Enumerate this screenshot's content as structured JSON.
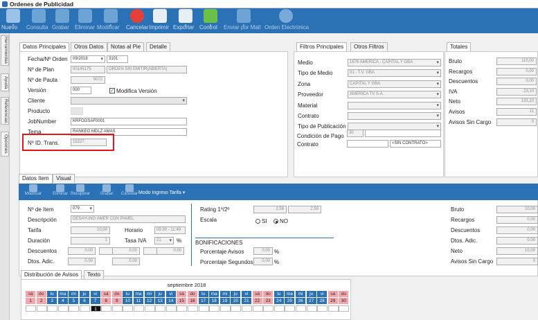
{
  "window": {
    "title": "Ordenes de Publicidad"
  },
  "toolbar": [
    {
      "label": "Nuevo",
      "dd": true,
      "color": "#9cc2e8",
      "icon": "new-icon",
      "enabled": true
    },
    {
      "label": "Consulta",
      "color": "#7fb0dd",
      "icon": "search-icon",
      "enabled": false
    },
    {
      "label": "Grabar",
      "color": "#7fb0dd",
      "icon": "save-icon",
      "enabled": false
    },
    {
      "label": "Eliminar",
      "color": "#7fb0dd",
      "icon": "delete-icon",
      "enabled": false
    },
    {
      "label": "Modificar",
      "dd": true,
      "color": "#7fb0dd",
      "icon": "edit-icon",
      "enabled": false
    },
    {
      "label": "Cancelar",
      "color": "#e4403a",
      "icon": "cancel-icon",
      "enabled": true
    },
    {
      "label": "Imprimir",
      "color": "#e9eef3",
      "icon": "printer-icon",
      "enabled": true
    },
    {
      "label": "Exportar",
      "dd": true,
      "color": "#e9eef3",
      "icon": "export-icon",
      "enabled": true
    },
    {
      "label": "Control",
      "dd": true,
      "color": "#6cc04a",
      "icon": "control-icon",
      "enabled": true
    },
    {
      "label": "Enviar por Mail",
      "dd": true,
      "color": "#7fb0dd",
      "icon": "mail-icon",
      "enabled": false
    },
    {
      "label": "Orden Electrónica",
      "color": "#8cb8e2",
      "icon": "electronic-order-icon",
      "enabled": false
    }
  ],
  "sidebar": [
    "Herramientas",
    "Ayuda",
    "Referencias",
    "Opciones"
  ],
  "main_tabs": [
    "Datos Principales",
    "Otros Datos",
    "Notas al Pie",
    "Detalle"
  ],
  "main": {
    "fecha_label": "Fecha/Nº Orden",
    "fecha": "09/2018",
    "orden": "3101",
    "plan_label": "Nº de Plan",
    "plan": "00145175",
    "plan_desc": "ORDEN SIN EMITIR(ABIERTA)",
    "pauta_label": "Nº de Pauta",
    "pauta": "0072",
    "version_label": "Versión",
    "version": "000",
    "modifica": "Modifica Versión",
    "cliente_label": "Cliente",
    "producto_label": "Producto",
    "job_label": "JobNumber",
    "job": "KRFOOSAF0001",
    "tema_label": "Tema",
    "tema": "RANKEO MDLZ AMAS",
    "trans_label": "Nº ID. Trans.",
    "trans": "15227"
  },
  "filter_tabs": [
    "Filtros Principales",
    "Otros Filtros"
  ],
  "filters": [
    {
      "label": "Medio",
      "value": "1676 AMERICA - CAPITAL Y GBA"
    },
    {
      "label": "Tipo de Medio",
      "value": "01 - T.V. GBA"
    },
    {
      "label": "Zona",
      "value": "CAPITAL Y GBA"
    },
    {
      "label": "Proveedor",
      "value": "AMERICA TV S.A."
    },
    {
      "label": "Material",
      "value": ""
    },
    {
      "label": "Contrato",
      "value": ""
    },
    {
      "label": "Tipo de Publicación",
      "value": ""
    }
  ],
  "condicion": {
    "label": "Condición de Pago",
    "value": "30"
  },
  "contrato2": {
    "label": "Contrato",
    "value": "<SIN CONTRATO>"
  },
  "totals_tab": "Totales",
  "totals": [
    {
      "label": "Bruto",
      "value": "110,00"
    },
    {
      "label": "Recargos",
      "value": "0,00"
    },
    {
      "label": "Descuentos",
      "value": "0,00"
    },
    {
      "label": "IVA",
      "value": "23,10"
    },
    {
      "label": "Neto",
      "value": "133,10"
    },
    {
      "label": "Avisos",
      "value": "11"
    },
    {
      "label": "Avisos Sin Cargo",
      "value": "0"
    }
  ],
  "item_tabs": [
    "Datos Item",
    "Visual"
  ],
  "item_toolbar": [
    "Modificar",
    "Eliminar",
    "Recuperar",
    "Grabar",
    "Cancelar"
  ],
  "ingreso": "Modo Ingreso Tarifa",
  "item": {
    "nro_label": "Nº de Item",
    "nro": "079",
    "desc_label": "Descripción",
    "desc": "DESAYUNO AMER CON PAMEL",
    "tarifa_label": "Tarifa",
    "tarifa": "10,00",
    "horario_label": "Horario",
    "horario": "09:30 - 11:49",
    "dur_label": "Duración",
    "dur": "1",
    "tasa_label": "Tasa IVA",
    "tasa": "21",
    "pct": "%",
    "desc2_label": "Descuentos",
    "dtos_label": "Dtos. Adic.",
    "zero": "0,00"
  },
  "rating": {
    "label": "Rating 1º/2º",
    "v1": "2,59",
    "v2": "2,59",
    "escala": "Escala",
    "si": "SI",
    "no": "NO"
  },
  "bonif": {
    "title": "BONIFICACIONES",
    "avisos": "Porcentaje Avisos",
    "segundos": "Porcentaje Segundos",
    "value": "0,00",
    "pct": "%"
  },
  "item_totals": [
    {
      "label": "Bruto",
      "value": "10,00"
    },
    {
      "label": "Recargos",
      "value": "0,00"
    },
    {
      "label": "Descuentos",
      "value": "0,00"
    },
    {
      "label": "Dtos. Adic.",
      "value": "0,00"
    },
    {
      "label": "Neto",
      "value": "10,00"
    },
    {
      "label": "Avisos Sin Cargo",
      "value": "0"
    }
  ],
  "dist_tabs": [
    "Distribución de Avisos",
    "Texto"
  ],
  "calendar": {
    "month": "septiembre 2018",
    "weekdays": [
      "sá",
      "do",
      "lu",
      "ma",
      "mi",
      "ju",
      "vi",
      "sá",
      "do",
      "lu",
      "ma",
      "mi",
      "ju",
      "vi",
      "sá",
      "do",
      "lu",
      "ma",
      "mi",
      "ju",
      "vi",
      "sá",
      "do",
      "lu",
      "ma",
      "mi",
      "ju",
      "vi",
      "sá",
      "do"
    ],
    "days": [
      "1",
      "2",
      "3",
      "4",
      "5",
      "6",
      "7",
      "8",
      "9",
      "10",
      "11",
      "12",
      "13",
      "14",
      "15",
      "16",
      "17",
      "18",
      "19",
      "20",
      "21",
      "22",
      "23",
      "24",
      "25",
      "26",
      "27",
      "28",
      "29",
      "30"
    ],
    "marked_value": "1"
  }
}
